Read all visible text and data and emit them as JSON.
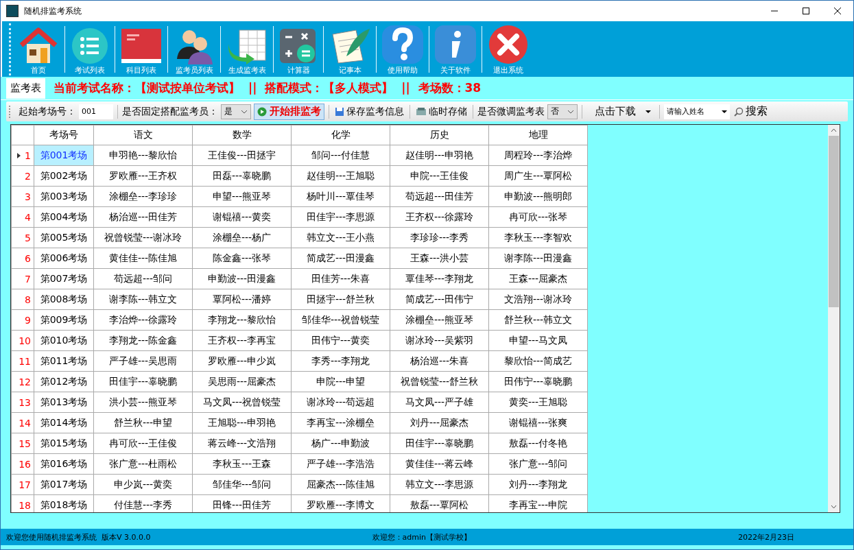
{
  "window": {
    "title": "随机排监考系统"
  },
  "toolbar": [
    {
      "kind": "home",
      "label": "首页"
    },
    {
      "kind": "list",
      "label": "考试列表"
    },
    {
      "kind": "book",
      "label": "科目列表"
    },
    {
      "kind": "people",
      "label": "监考员列表"
    },
    {
      "kind": "sheet",
      "label": "生成监考表"
    },
    {
      "kind": "calculator",
      "label": "计算器"
    },
    {
      "kind": "notepad",
      "label": "记事本"
    },
    {
      "kind": "help",
      "label": "使用帮助"
    },
    {
      "kind": "info",
      "label": "关于软件"
    },
    {
      "kind": "exit",
      "label": "退出系统"
    }
  ],
  "tab": {
    "label": "监考表"
  },
  "info": "当前考试名称：【测试按单位考试】 || 搭配模式：【多人模式】 || 考场数：38",
  "controls": {
    "start_label": "起始考场号：",
    "start_value": "001",
    "fixed_label": "是否固定搭配监考员：",
    "fixed_value": "是",
    "start_button": "开始排监考",
    "save_button": "保存监考信息",
    "temp_button": "临时存储",
    "adjust_label": "是否微调监考表",
    "adjust_value": "否",
    "download_button": "点击下载",
    "name_placeholder": "请输入姓名",
    "search_button": "搜索"
  },
  "table": {
    "columns": [
      "考场号",
      "语文",
      "数学",
      "化学",
      "历史",
      "地理"
    ],
    "rows": [
      {
        "no": "1",
        "selected": true,
        "cells": [
          "第001考场",
          "申羽艳---黎欣怡",
          "王佳俊---田拯宇",
          "邹问---付佳慧",
          "赵佳明---申羽艳",
          "周程玲---李治烨"
        ]
      },
      {
        "no": "2",
        "selected": false,
        "cells": [
          "第002考场",
          "罗欧雁---王齐权",
          "田磊---辜晓鹏",
          "赵佳明---王旭聪",
          "申院---王佳俊",
          "周广生---覃阿松"
        ]
      },
      {
        "no": "3",
        "selected": false,
        "cells": [
          "第003考场",
          "涂棚垒---李珍珍",
          "申望---熊亚琴",
          "杨叶川---覃佳琴",
          "苟远超---田佳芳",
          "申勤波---熊明郎"
        ]
      },
      {
        "no": "4",
        "selected": false,
        "cells": [
          "第004考场",
          "杨治巡---田佳芳",
          "谢锟禧---黄奕",
          "田佳宇---李思源",
          "王齐权---徐露玲",
          "冉可欣---张琴"
        ]
      },
      {
        "no": "5",
        "selected": false,
        "cells": [
          "第005考场",
          "祝曾锐莹---谢冰玲",
          "涂棚垒---杨广",
          "韩立文---王小燕",
          "李珍珍---李秀",
          "李秋玉---李智欢"
        ]
      },
      {
        "no": "6",
        "selected": false,
        "cells": [
          "第006考场",
          "黄佳佳---陈佳旭",
          "陈金鑫---张琴",
          "简成艺---田漫鑫",
          "王森---洪小芸",
          "谢李陈---田漫鑫"
        ]
      },
      {
        "no": "7",
        "selected": false,
        "cells": [
          "第007考场",
          "苟远超---邹问",
          "申勤波---田漫鑫",
          "田佳芳---朱喜",
          "覃佳琴---李翔龙",
          "王森---屈豪杰"
        ]
      },
      {
        "no": "8",
        "selected": false,
        "cells": [
          "第008考场",
          "谢李陈---韩立文",
          "覃阿松---潘婷",
          "田拯宇---舒兰秋",
          "简成艺---田伟宁",
          "文浩翔---谢冰玲"
        ]
      },
      {
        "no": "9",
        "selected": false,
        "cells": [
          "第009考场",
          "李治烨---徐露玲",
          "李翔龙---黎欣怡",
          "邹佳华---祝曾锐莹",
          "涂棚垒---熊亚琴",
          "舒兰秋---韩立文"
        ]
      },
      {
        "no": "10",
        "selected": false,
        "cells": [
          "第010考场",
          "李翔龙---陈金鑫",
          "王齐权---李再宝",
          "田伟宁---黄奕",
          "谢冰玲---吴紫羽",
          "申望---马文凤"
        ]
      },
      {
        "no": "11",
        "selected": false,
        "cells": [
          "第011考场",
          "严子雄---吴思雨",
          "罗欧雁---申少岚",
          "李秀---李翔龙",
          "杨治巡---朱喜",
          "黎欣怡---简成艺"
        ]
      },
      {
        "no": "12",
        "selected": false,
        "cells": [
          "第012考场",
          "田佳宇---辜晓鹏",
          "吴思雨---屈豪杰",
          "申院---申望",
          "祝曾锐莹---舒兰秋",
          "田伟宁---辜晓鹏"
        ]
      },
      {
        "no": "13",
        "selected": false,
        "cells": [
          "第013考场",
          "洪小芸---熊亚琴",
          "马文凤---祝曾锐莹",
          "谢冰玲---苟远超",
          "马文凤---严子雄",
          "黄奕---王旭聪"
        ]
      },
      {
        "no": "14",
        "selected": false,
        "cells": [
          "第014考场",
          "舒兰秋---申望",
          "王旭聪---申羽艳",
          "李再宝---涂棚垒",
          "刘丹---屈豪杰",
          "谢锟禧---张爽"
        ]
      },
      {
        "no": "15",
        "selected": false,
        "cells": [
          "第015考场",
          "冉可欣---王佳俊",
          "蒋云峰---文浩翔",
          "杨广---申勤波",
          "田佳宇---辜晓鹏",
          "敖磊---付冬艳"
        ]
      },
      {
        "no": "16",
        "selected": false,
        "cells": [
          "第016考场",
          "张广意---杜雨松",
          "李秋玉---王森",
          "严子雄---李浩浩",
          "黄佳佳---蒋云峰",
          "张广意---邹问"
        ]
      },
      {
        "no": "17",
        "selected": false,
        "cells": [
          "第017考场",
          "申少岚---黄奕",
          "邹佳华---邹问",
          "屈豪杰---陈佳旭",
          "韩立文---李思源",
          "刘丹---李翔龙"
        ]
      },
      {
        "no": "18",
        "selected": false,
        "cells": [
          "第018考场",
          "付佳慧---李秀",
          "田锋---田佳芳",
          "罗欧雁---李博文",
          "敖磊---覃阿松",
          "李再宝---申院"
        ]
      }
    ]
  },
  "status_bar": {
    "left": "欢迎您使用随机排监考系统  版本V 3.0.0.0",
    "center": "欢迎您：admin【测试学校】",
    "right": "2022年2月23日"
  }
}
